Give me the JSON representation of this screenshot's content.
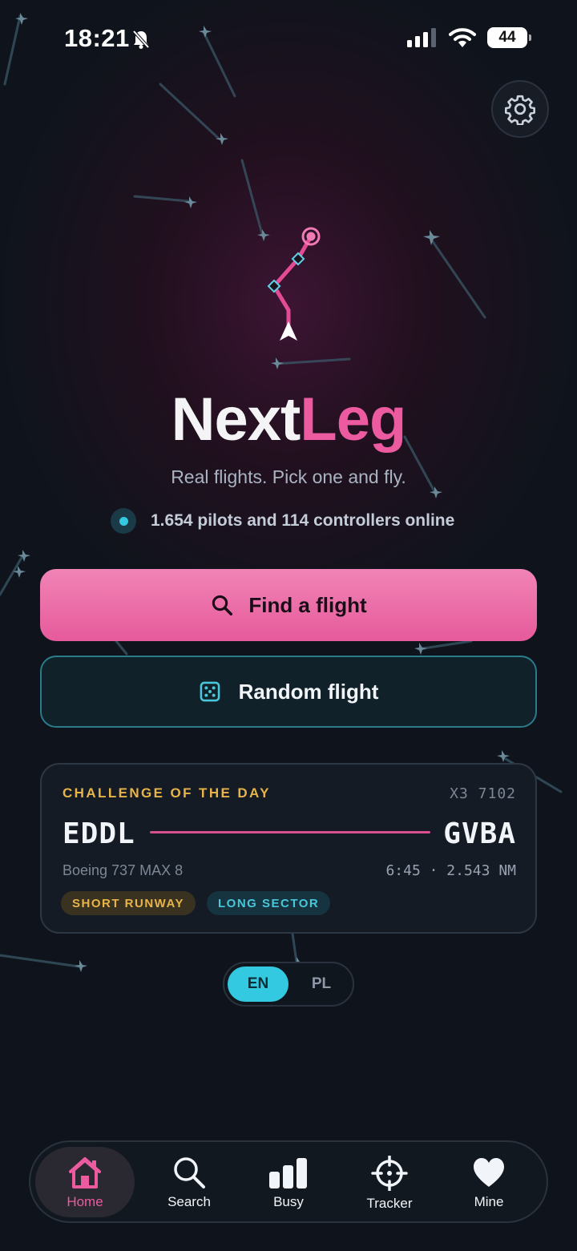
{
  "status_bar": {
    "time": "18:21",
    "battery": "44"
  },
  "brand": {
    "name_part1": "Next",
    "name_part2": "Leg",
    "tagline": "Real flights. Pick one and fly."
  },
  "online_status": "1.654 pilots and 114 controllers online",
  "actions": {
    "find_flight": "Find a flight",
    "random_flight": "Random flight"
  },
  "challenge": {
    "label": "CHALLENGE OF THE DAY",
    "flight_code": "X3 7102",
    "origin": "EDDL",
    "destination": "GVBA",
    "aircraft": "Boeing 737 MAX 8",
    "stats": "6:45 · 2.543 NM",
    "tags": [
      "SHORT RUNWAY",
      "LONG SECTOR"
    ]
  },
  "language": {
    "options": [
      "EN",
      "PL"
    ],
    "selected": "EN"
  },
  "tabs": [
    {
      "label": "Home",
      "icon": "home-icon",
      "active": true
    },
    {
      "label": "Search",
      "icon": "search-icon",
      "active": false
    },
    {
      "label": "Busy",
      "icon": "bar-chart-icon",
      "active": false
    },
    {
      "label": "Tracker",
      "icon": "crosshair-icon",
      "active": false
    },
    {
      "label": "Mine",
      "icon": "heart-icon",
      "active": false
    }
  ],
  "colors": {
    "accent_pink": "#ec5aa0",
    "accent_cyan": "#33c9e0",
    "accent_amber": "#e8b44a",
    "background": "#0f141c"
  }
}
